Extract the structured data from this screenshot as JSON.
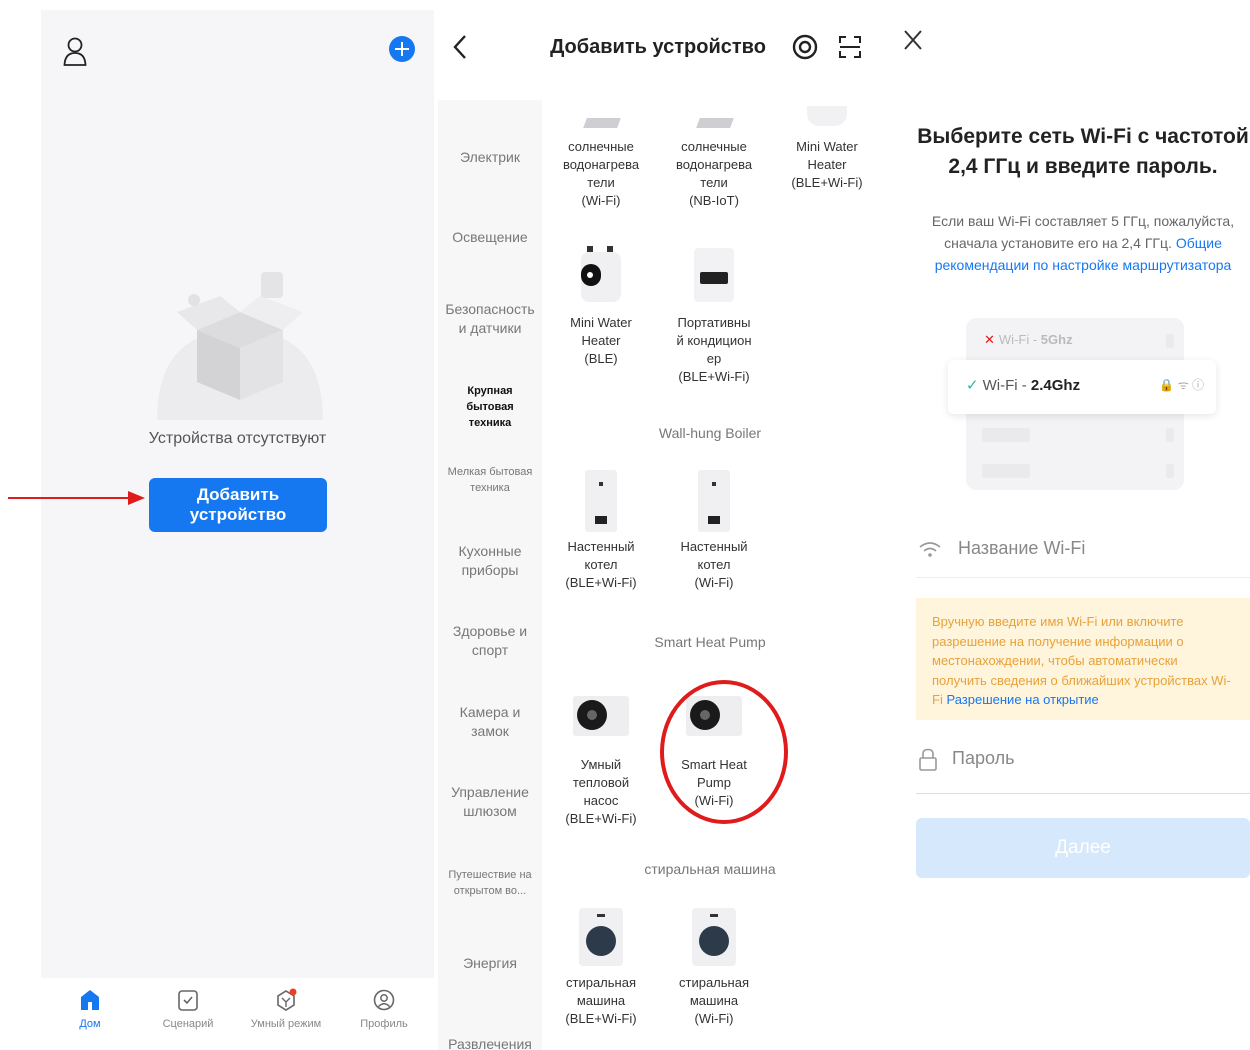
{
  "home": {
    "empty_text": "Устройства отсутствуют",
    "add_device_button": "Добавить устройство",
    "tabs": [
      {
        "label": "Дом",
        "icon": "home-icon",
        "active": true
      },
      {
        "label": "Сценарий",
        "icon": "scenario-icon",
        "active": false
      },
      {
        "label": "Умный режим",
        "icon": "smart-mode-icon",
        "active": false
      },
      {
        "label": "Профиль",
        "icon": "profile-icon",
        "active": false
      }
    ],
    "accent_color": "#1678f0"
  },
  "add_device": {
    "title": "Добавить устройство",
    "categories": [
      {
        "label": "Электрик"
      },
      {
        "label": "Освещение"
      },
      {
        "label": "Безопасность и датчики"
      },
      {
        "label": "Крупная бытовая техника",
        "active": true
      },
      {
        "label": "Мелкая бытовая техника"
      },
      {
        "label": "Кухонные приборы"
      },
      {
        "label": "Здоровье и спорт"
      },
      {
        "label": "Камера и замок"
      },
      {
        "label": "Управление шлюзом"
      },
      {
        "label": "Путешествие на открытом во..."
      },
      {
        "label": "Энергия"
      },
      {
        "label": "Развлечения"
      }
    ],
    "devices_top": [
      {
        "l1": "солнечные",
        "l2": "водонагрева",
        "l3": "тели",
        "l4": "(Wi-Fi)"
      },
      {
        "l1": "солнечные",
        "l2": "водонагрева",
        "l3": "тели",
        "l4": "(NB-IoT)"
      },
      {
        "l1": "Mini Water",
        "l2": "Heater",
        "l3": "(BLE+Wi-Fi)",
        "l4": ""
      },
      {
        "l1": "Mini Water",
        "l2": "Heater",
        "l3": "(BLE)",
        "l4": ""
      },
      {
        "l1": "Портативны",
        "l2": "й кондицион",
        "l3": "ер",
        "l4": "(BLE+Wi-Fi)"
      }
    ],
    "sections": [
      "Wall-hung Boiler",
      "Smart Heat Pump",
      "стиральная машина"
    ],
    "boilers": [
      {
        "l1": "Настенный",
        "l2": "котел",
        "l3": "(BLE+Wi-Fi)"
      },
      {
        "l1": "Настенный",
        "l2": "котел",
        "l3": "(Wi-Fi)"
      }
    ],
    "pumps": [
      {
        "l1": "Умный",
        "l2": "тепловой",
        "l3": "насос",
        "l4": "(BLE+Wi-Fi)"
      },
      {
        "l1": "Smart Heat",
        "l2": "Pump",
        "l3": "(Wi-Fi)",
        "l4": ""
      }
    ],
    "washers": [
      {
        "l1": "стиральная",
        "l2": "машина",
        "l3": "(BLE+Wi-Fi)"
      },
      {
        "l1": "стиральная",
        "l2": "машина",
        "l3": "(Wi-Fi)"
      }
    ],
    "highlight_color": "#e01b1b"
  },
  "wifi": {
    "heading_line1": "Выберите сеть Wi-Fi с частотой",
    "heading_line2": "2,4 ГГц и введите пароль.",
    "desc": "Если ваш Wi-Fi составляет 5 ГГц, пожалуйста, сначала установите его на 2,4 ГГц.",
    "desc_link": "Общие рекомендации по настройке маршрутизатора",
    "net_5": "Wi-Fi - ",
    "net_5_bold": "5Ghz",
    "net_24": "Wi-Fi - ",
    "net_24_bold": "2.4Ghz",
    "ssid_placeholder": "Название Wi-Fi",
    "warning": "Вручную введите имя Wi-Fi или включите разрешение на получение информации о местонахождении, чтобы автоматически получить сведения о ближайших устройствах Wi-Fi",
    "warning_link": "Разрешение на открытие",
    "password_placeholder": "Пароль",
    "next_button": "Далее",
    "warning_color": "#e8a23a"
  }
}
